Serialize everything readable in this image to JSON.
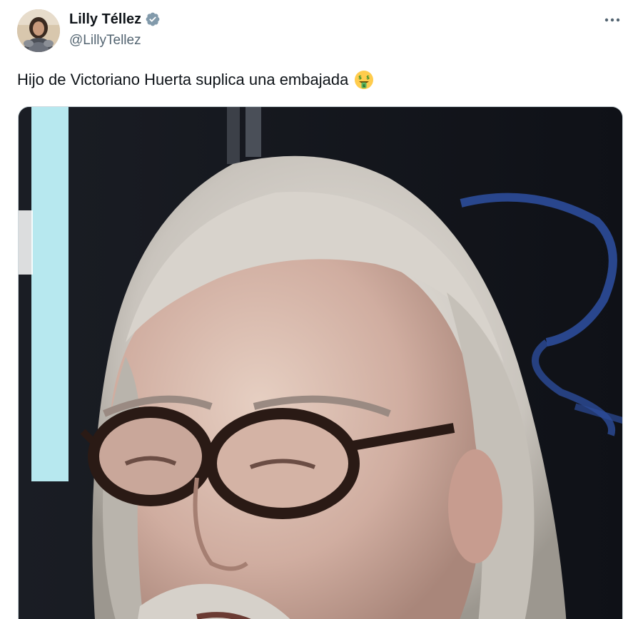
{
  "author": {
    "display_name": "Lilly Téllez",
    "handle": "@LillyTellez",
    "verified": true,
    "verified_icon": "verified-badge-icon",
    "verified_color": "#829aab",
    "avatar_icon": "profile-avatar"
  },
  "tweet": {
    "text": "Hijo de Victoriano Huerta suplica una embajada",
    "emoji_icon": "money-mouth-face-emoji"
  },
  "actions": {
    "more_icon": "more-options-icon"
  },
  "media": {
    "type": "video-still",
    "subject": "man-with-white-hair-and-glasses"
  },
  "colors": {
    "text_primary": "#0f1419",
    "text_secondary": "#536471",
    "border": "#cfd9de"
  }
}
